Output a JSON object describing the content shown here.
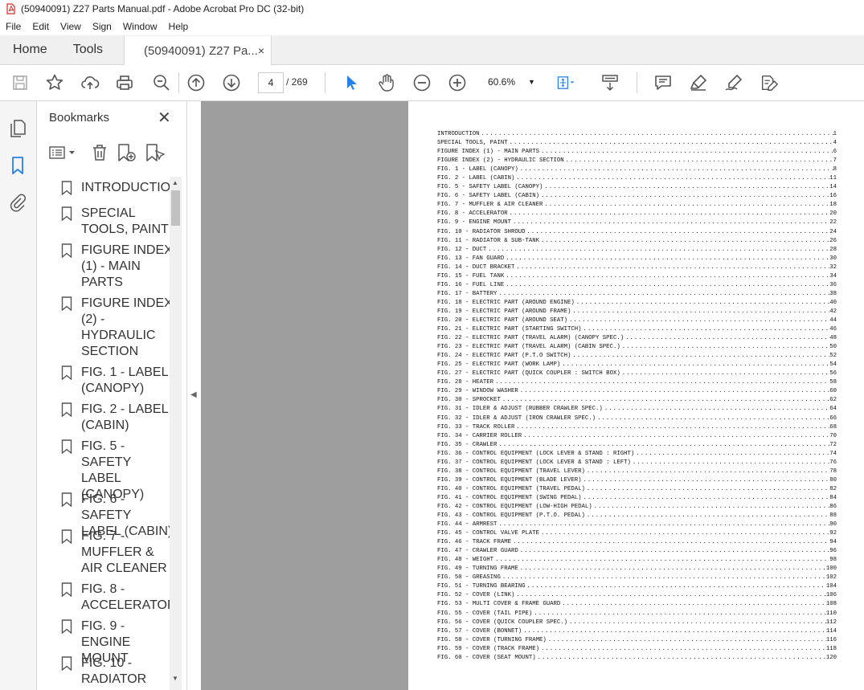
{
  "window": {
    "title": "(50940091) Z27 Parts Manual.pdf - Adobe Acrobat Pro DC (32-bit)"
  },
  "menu": [
    "File",
    "Edit",
    "View",
    "Sign",
    "Window",
    "Help"
  ],
  "tabs": {
    "home": "Home",
    "tools": "Tools",
    "document": "(50940091) Z27 Pa...",
    "close": "×"
  },
  "toolbar": {
    "page_current": "4",
    "page_total": "/ 269",
    "zoom": "60.6%"
  },
  "bookmarks": {
    "title": "Bookmarks",
    "close": "✕",
    "items": [
      {
        "label": "INTRODUCTION"
      },
      {
        "label": "SPECIAL TOOLS, PAINT"
      },
      {
        "label": "FIGURE INDEX (1) - MAIN PARTS"
      },
      {
        "label": "FIGURE INDEX (2) - HYDRAULIC SECTION"
      },
      {
        "label": "FIG. 1 - LABEL (CANOPY)"
      },
      {
        "label": "FIG. 2 - LABEL (CABIN)"
      },
      {
        "label": "FIG. 5 - SAFETY LABEL (CANOPY)"
      },
      {
        "label": "FIG. 6 - SAFETY LABEL (CABIN)"
      },
      {
        "label": "FIG. 7 - MUFFLER & AIR CLEANER"
      },
      {
        "label": "FIG. 8 - ACCELERATOR"
      },
      {
        "label": "FIG. 9 - ENGINE MOUNT"
      },
      {
        "label": "FIG. 10 - RADIATOR"
      }
    ]
  },
  "toc": [
    {
      "title": "INTRODUCTION",
      "page": "1"
    },
    {
      "title": "SPECIAL TOOLS, PAINT",
      "page": "4"
    },
    {
      "title": "FIGURE INDEX (1) - MAIN PARTS",
      "page": "6"
    },
    {
      "title": "FIGURE INDEX (2) - HYDRAULIC SECTION",
      "page": "7"
    },
    {
      "title": "FIG. 1 - LABEL (CANOPY)",
      "page": "8"
    },
    {
      "title": "FIG. 2 - LABEL (CABIN)",
      "page": "11"
    },
    {
      "title": "FIG. 5 - SAFETY LABEL (CANOPY)",
      "page": "14"
    },
    {
      "title": "FIG. 6 - SAFETY LABEL (CABIN)",
      "page": "16"
    },
    {
      "title": "FIG. 7 - MUFFLER & AIR CLEANER",
      "page": "18"
    },
    {
      "title": "FIG. 8 - ACCELERATOR",
      "page": "20"
    },
    {
      "title": "FIG. 9 - ENGINE MOUNT",
      "page": "22"
    },
    {
      "title": "FIG. 10 - RADIATOR SHROUD",
      "page": "24"
    },
    {
      "title": "FIG. 11 - RADIATOR & SUB-TANK",
      "page": "26"
    },
    {
      "title": "FIG. 12 - DUCT",
      "page": "28"
    },
    {
      "title": "FIG. 13 - FAN GUARD",
      "page": "30"
    },
    {
      "title": "FIG. 14 - DUCT BRACKET",
      "page": "32"
    },
    {
      "title": "FIG. 15 - FUEL TANK",
      "page": "34"
    },
    {
      "title": "FIG. 16 - FUEL LINE",
      "page": "36"
    },
    {
      "title": "FIG. 17 - BATTERY",
      "page": "38"
    },
    {
      "title": "FIG. 18 - ELECTRIC PART (AROUND ENGINE)",
      "page": "40"
    },
    {
      "title": "FIG. 19 - ELECTRIC PART (AROUND FRAME)",
      "page": "42"
    },
    {
      "title": "FIG. 20 - ELECTRIC PART (AROUND SEAT)",
      "page": "44"
    },
    {
      "title": "FIG. 21 - ELECTRIC PART (STARTING SWITCH)",
      "page": "46"
    },
    {
      "title": "FIG. 22 - ELECTRIC PART (TRAVEL ALARM) (CANOPY SPEC.)",
      "page": "48"
    },
    {
      "title": "FIG. 23 - ELECTRIC PART (TRAVEL ALARM) (CABIN SPEC.)",
      "page": "50"
    },
    {
      "title": "FIG. 24 - ELECTRIC PART (P.T.O SWITCH)",
      "page": "52"
    },
    {
      "title": "FIG. 25 - ELECTRIC PART (WORK LAMP)",
      "page": "54"
    },
    {
      "title": "FIG. 27 - ELECTRIC PART (QUICK COUPLER : SWITCH BOX)",
      "page": "56"
    },
    {
      "title": "FIG. 28 - HEATER",
      "page": "58"
    },
    {
      "title": "FIG. 29 - WINDOW WASHER",
      "page": "60"
    },
    {
      "title": "FIG. 30 - SPROCKET",
      "page": "62"
    },
    {
      "title": "FIG. 31 - IDLER & ADJUST (RUBBER CRAWLER SPEC.)",
      "page": "64"
    },
    {
      "title": "FIG. 32 - IDLER & ADJUST (IRON CRAWLER SPEC.)",
      "page": "66"
    },
    {
      "title": "FIG. 33 - TRACK ROLLER",
      "page": "68"
    },
    {
      "title": "FIG. 34 - CARRIER ROLLER",
      "page": "70"
    },
    {
      "title": "FIG. 35 - CRAWLER",
      "page": "72"
    },
    {
      "title": "FIG. 36 - CONTROL EQUIPMENT (LOCK LEVER & STAND : RIGHT)",
      "page": "74"
    },
    {
      "title": "FIG. 37 - CONTROL EQUIPMENT (LOCK LEVER & STAND : LEFT)",
      "page": "76"
    },
    {
      "title": "FIG. 38 - CONTROL EQUIPMENT (TRAVEL LEVER)",
      "page": "78"
    },
    {
      "title": "FIG. 39 - CONTROL EQUIPMENT (BLADE LEVER)",
      "page": "80"
    },
    {
      "title": "FIG. 40 - CONTROL EQUIPMENT (TRAVEL PEDAL)",
      "page": "82"
    },
    {
      "title": "FIG. 41 - CONTROL EQUIPMENT (SWING PEDAL)",
      "page": "84"
    },
    {
      "title": "FIG. 42 - CONTROL EQUIPMENT (LOW-HIGH PEDAL)",
      "page": "86"
    },
    {
      "title": "FIG. 43 - CONTROL EQUIPMENT (P.T.O. PEDAL)",
      "page": "88"
    },
    {
      "title": "FIG. 44 - ARMREST",
      "page": "90"
    },
    {
      "title": "FIG. 45 - CONTROL VALVE PLATE",
      "page": "92"
    },
    {
      "title": "FIG. 46 - TRACK FRAME",
      "page": "94"
    },
    {
      "title": "FIG. 47 - CRAWLER GUARD",
      "page": "96"
    },
    {
      "title": "FIG. 48 - WEIGHT",
      "page": "98"
    },
    {
      "title": "FIG. 49 - TURNING FRAME",
      "page": "100"
    },
    {
      "title": "FIG. 50 - GREASING",
      "page": "102"
    },
    {
      "title": "FIG. 51 - TURNING BEARING",
      "page": "104"
    },
    {
      "title": "FIG. 52 - COVER (LINK)",
      "page": "106"
    },
    {
      "title": "FIG. 53 - MULTI COVER & FRAME GUARD",
      "page": "108"
    },
    {
      "title": "FIG. 55 - COVER (TAIL PIPE)",
      "page": "110"
    },
    {
      "title": "FIG. 56 - COVER (QUICK COUPLER SPEC.)",
      "page": "112"
    },
    {
      "title": "FIG. 57 - COVER (BONNET)",
      "page": "114"
    },
    {
      "title": "FIG. 58 - COVER (TURNING FRAME)",
      "page": "116"
    },
    {
      "title": "FIG. 59 - COVER (TRACK FRAME)",
      "page": "118"
    },
    {
      "title": "FIG. 60 - COVER (SEAT MOUNT)",
      "page": "120"
    }
  ],
  "colors": {
    "accent": "#2680eb",
    "pdf_red": "#d9281c",
    "viewer_bg": "#9e9e9e"
  },
  "icons": {
    "toolbar": [
      "save-icon",
      "bookmark-star-icon",
      "upload-icon",
      "print-icon",
      "zoom-search-icon",
      "page-up-icon",
      "page-down-icon",
      "select-arrow-icon",
      "hand-icon",
      "zoom-out-icon",
      "zoom-in-icon",
      "fit-page-icon",
      "scroll-mode-icon",
      "comment-icon",
      "highlight-icon",
      "sign-icon",
      "fill-sign-icon"
    ],
    "rail": [
      "pages-icon",
      "bookmarks-icon",
      "attachments-icon"
    ]
  }
}
